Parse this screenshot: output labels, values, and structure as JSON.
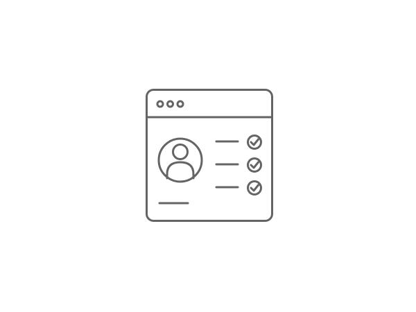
{
  "illustration": {
    "name": "user-profile-window-icon",
    "stroke_color": "#646464",
    "background_color": "#ffffff",
    "window_dots": 3,
    "checklist_items": 3,
    "all_items_checked": true
  }
}
